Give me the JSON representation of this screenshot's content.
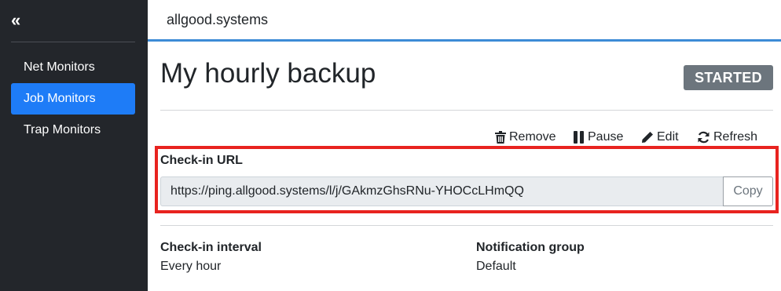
{
  "sidebar": {
    "collapse_glyph": "«",
    "items": [
      {
        "label": "Net Monitors",
        "active": false
      },
      {
        "label": "Job Monitors",
        "active": true
      },
      {
        "label": "Trap Monitors",
        "active": false
      }
    ]
  },
  "topbar": {
    "title": "allgood.systems"
  },
  "monitor": {
    "title": "My hourly backup",
    "status": "STARTED"
  },
  "actions": {
    "remove": "Remove",
    "pause": "Pause",
    "edit": "Edit",
    "refresh": "Refresh"
  },
  "checkin": {
    "label": "Check-in URL",
    "url": "https://ping.allgood.systems/l/j/GAkmzGhsRNu-YHOCcLHmQQ",
    "copy_label": "Copy"
  },
  "details": {
    "interval_label": "Check-in interval",
    "interval_value": "Every hour",
    "group_label": "Notification group",
    "group_value": "Default"
  },
  "colors": {
    "sidebar_bg": "#23262b",
    "active_nav": "#1e7cf7",
    "status_badge": "#6c757d",
    "highlight": "#e8231f",
    "topbar_accent": "#3d8bd6"
  }
}
